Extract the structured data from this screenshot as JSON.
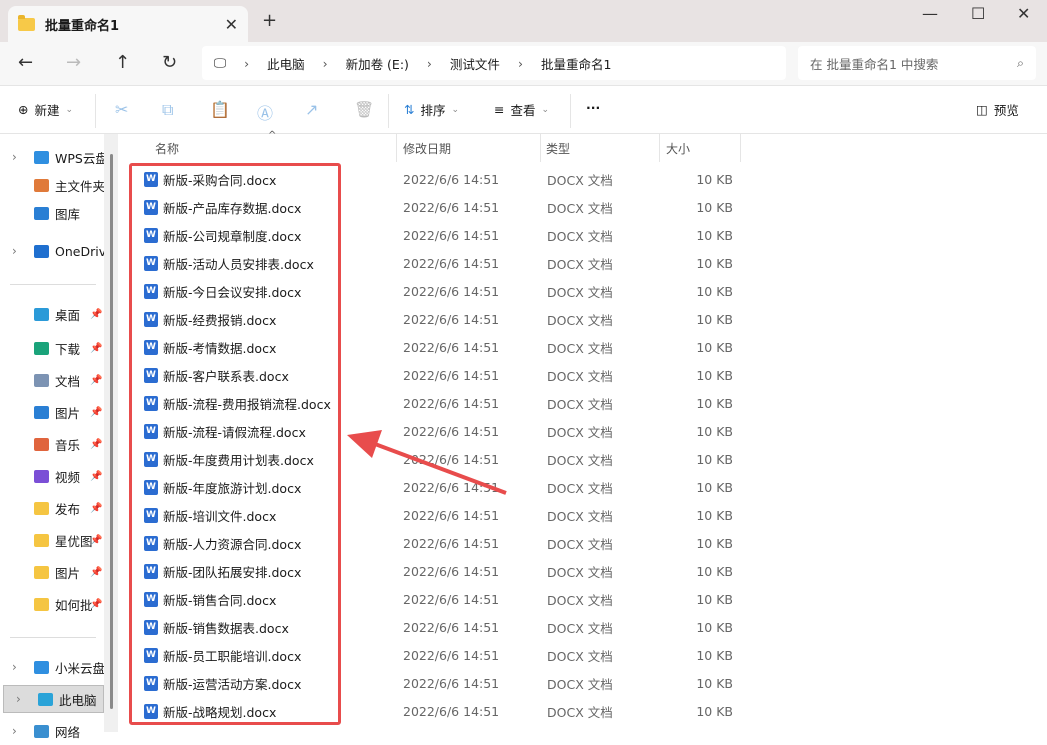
{
  "window": {
    "tab_title": "批量重命名1",
    "new_tab": "+",
    "close_tab": "✕"
  },
  "address": {
    "crumbs": [
      "此电脑",
      "新加卷 (E:)",
      "测试文件",
      "批量重命名1"
    ],
    "search_placeholder": "在 批量重命名1 中搜索"
  },
  "toolbar": {
    "new": "新建",
    "sort": "排序",
    "view": "查看",
    "more": "···",
    "preview": "预览"
  },
  "sidebar": {
    "items": [
      {
        "label": "WPS云盘",
        "chev": true,
        "color": "#2f8fe0",
        "pin": false
      },
      {
        "label": "主文件夹",
        "chev": false,
        "color": "#e07a3a",
        "pin": false
      },
      {
        "label": "图库",
        "chev": false,
        "color": "#2a7fd4",
        "pin": false
      },
      {
        "label": "OneDrive",
        "chev": true,
        "color": "#1f6fcf",
        "pin": false
      },
      {
        "label": "桌面",
        "chev": false,
        "color": "#2b9ad8",
        "pin": true
      },
      {
        "label": "下载",
        "chev": false,
        "color": "#1aa37a",
        "pin": true
      },
      {
        "label": "文档",
        "chev": false,
        "color": "#7c93b3",
        "pin": true
      },
      {
        "label": "图片",
        "chev": false,
        "color": "#2a7fd4",
        "pin": true
      },
      {
        "label": "音乐",
        "chev": false,
        "color": "#e0643d",
        "pin": true
      },
      {
        "label": "视频",
        "chev": false,
        "color": "#7b4fd6",
        "pin": true
      },
      {
        "label": "发布",
        "chev": false,
        "color": "#f5c542",
        "pin": true
      },
      {
        "label": "星优图",
        "chev": false,
        "color": "#f5c542",
        "pin": true
      },
      {
        "label": "图片",
        "chev": false,
        "color": "#f5c542",
        "pin": true
      },
      {
        "label": "如何批",
        "chev": false,
        "color": "#f5c542",
        "pin": true
      },
      {
        "label": "小米云盘",
        "chev": true,
        "color": "#2f8fe0",
        "pin": false
      },
      {
        "label": "此电脑",
        "chev": true,
        "color": "#2aa3d8",
        "pin": false
      },
      {
        "label": "网络",
        "chev": true,
        "color": "#3a8fd0",
        "pin": false
      }
    ]
  },
  "columns": {
    "name": "名称",
    "date": "修改日期",
    "type": "类型",
    "size": "大小"
  },
  "files": [
    "新版-采购合同.docx",
    "新版-产品库存数据.docx",
    "新版-公司规章制度.docx",
    "新版-活动人员安排表.docx",
    "新版-今日会议安排.docx",
    "新版-经费报销.docx",
    "新版-考情数据.docx",
    "新版-客户联系表.docx",
    "新版-流程-费用报销流程.docx",
    "新版-流程-请假流程.docx",
    "新版-年度费用计划表.docx",
    "新版-年度旅游计划.docx",
    "新版-培训文件.docx",
    "新版-人力资源合同.docx",
    "新版-团队拓展安排.docx",
    "新版-销售合同.docx",
    "新版-销售数据表.docx",
    "新版-员工职能培训.docx",
    "新版-运营活动方案.docx",
    "新版-战略规划.docx"
  ],
  "file_date": "2022/6/6 14:51",
  "file_type": "DOCX 文档",
  "file_size": "10 KB",
  "file_icon_letter": "W",
  "highlight_color": "#e84c4c"
}
